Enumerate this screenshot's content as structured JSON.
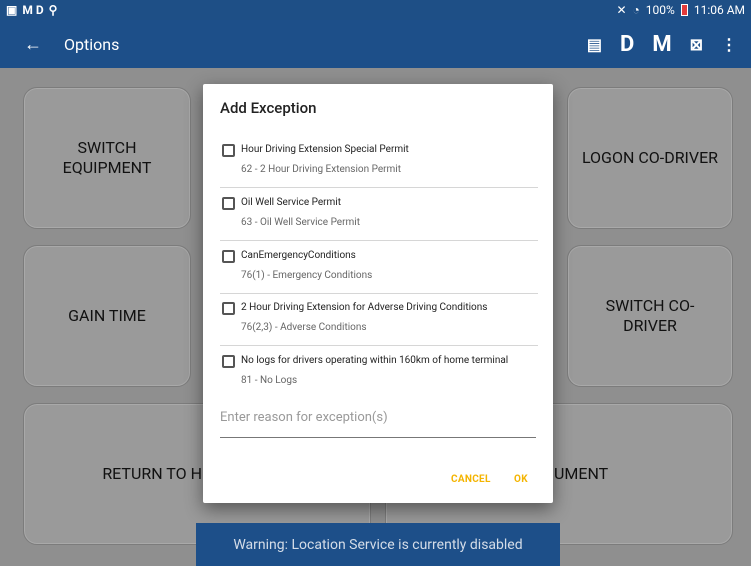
{
  "status_bar": {
    "left_text": "M D",
    "battery": "100%",
    "time": "11:06 AM"
  },
  "app_bar": {
    "title": "Options",
    "actions": [
      "D",
      "M"
    ]
  },
  "tiles": {
    "switch_equipment": "SWITCH EQUIPMENT",
    "gain_time": "GAIN TIME",
    "return_to": "RETURN TO H",
    "logon_codriver": "LOGON CO-DRIVER",
    "switch_codriver": "SWITCH CO-DRIVER",
    "equipment": "UMENT"
  },
  "dialog": {
    "title": "Add Exception",
    "options": [
      {
        "name": "Hour Driving Extension Special Permit",
        "code": "62 - 2 Hour Driving Extension Permit",
        "checked": false
      },
      {
        "name": "Oil Well Service Permit",
        "code": "63 - Oil Well Service Permit",
        "checked": false
      },
      {
        "name": "CanEmergencyConditions",
        "code": "76(1) - Emergency Conditions",
        "checked": false
      },
      {
        "name": "2 Hour Driving Extension for Adverse Driving Conditions",
        "code": "76(2,3) - Adverse Conditions",
        "checked": false
      },
      {
        "name": "No logs for drivers operating within 160km of home terminal",
        "code": "81 - No Logs",
        "checked": false
      }
    ],
    "reason_placeholder": "Enter reason for exception(s)",
    "cancel_label": "CANCEL",
    "ok_label": "OK"
  },
  "toast": "Warning: Location Service is currently disabled",
  "colors": {
    "app_bar": "#1d4f89",
    "accent": "#f4b400"
  }
}
